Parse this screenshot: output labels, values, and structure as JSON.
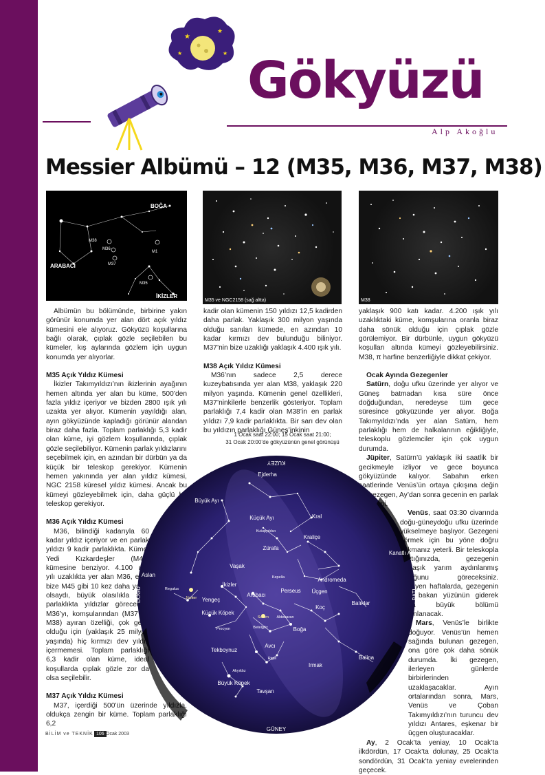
{
  "header": {
    "title": "Gökyüzü",
    "author": "Alp Akoğlu"
  },
  "headline": "Messier Albümü – 12 (M35, M36, M37, M38)",
  "photos": {
    "chart": {
      "labels": {
        "boga": "BOĞA",
        "arabaci": "ARABACI",
        "ikizler": "İKİZLER",
        "m38": "M38",
        "m36": "M36",
        "m37": "M37",
        "m1": "M1",
        "m35": "M35"
      }
    },
    "m35_caption": "M35 ve NGC2158 (sağ altta)",
    "m38_caption": "M38"
  },
  "col1": {
    "intro": "Albümün bu bölümünde, birbirine yakın görünür konumda yer alan dört açık yıldız kümesini ele alıyoruz. Gökyüzü koşullarına bağlı olarak, çıplak gözle seçilebilen bu kümeler, kış aylarında gözlem için uygun konumda yer alıyorlar.",
    "m35_head": "M35 Açık Yıldız Kümesi",
    "m35_text": "İkizler Takımyıldızı’nın ikizlerinin ayağının hemen altında yer alan bu küme, 500’den fazla yıldız içeriyor ve bizden 2800 ışık yılı uzakta yer alıyor. Kümenin yayıldığı alan, ayın gökyüzünde kapladığı görünür alandan biraz daha fazla. Toplam parlaklığı 5,3 kadir olan küme, iyi gözlem koşullarında, çıplak gözle seçilebiliyor. Kümenin parlak yıldızlarını seçebilmek için, en azından bir dürbün ya da küçük bir teleskop gerekiyor. Kümenin hemen yakınında yer alan yıldız kümesi, NGC 2158 küresel yıldız kümesi. Ancak bu kümeyi gözleyebilmek için, daha güçlü bir teleskop gerekiyor.",
    "m36_head": "M36 Açık Yıldız Kümesi",
    "m36_text": "M36, bilindiği kadarıyla 60 kadar yıldız içeriyor ve en parlak yıldızı 9 kadir parlaklıkta. Küme, Yedi Kızkardeşler (M45) kümesine benziyor. 4.100 ışık yılı uzaklıkta yer alan M36, eğer bize M45 gibi 10 kez daha yakın olsaydı, büyük olasılıkla aynı parlaklıkta yıldızlar görecektik. M36’yı, komşularından (M37 ve M38) ayıran özelliği, çok genç olduğu için (yaklaşık 25 milyon yaşında) hiç kırmızı dev yıldız içermemesi. Toplam parlaklığı 6,3 kadir olan küme, ideal koşullarda çıplak gözle zor da olsa seçilebilir.",
    "m37_head": "M37 Açık Yıldız Kümesi",
    "m37_text": "M37, içerdiği 500’ün üzerinde yıldızla, oldukça zengin bir küme. Toplam parlaklığı 6,2"
  },
  "col2": {
    "cont": "kadir olan kümenin 150 yıldızı 12,5 kadirden daha parlak. Yaklaşık 300 milyon yaşında olduğu sanılan kümede, en azından 10 kadar kırmızı dev bulunduğu biliniyor. M37’nin bize uzaklığı yaklaşık 4.400 ışık yılı.",
    "m38_head": "M38 Açık Yıldız Kümesi",
    "m38_text": "M36’nın sadece 2,5 derece kuzeybatısında yer alan M38, yaklaşık 220 milyon yaşında. Kümenin genel özellikleri, M37’ninkilerle benzerlik gösteriyor. Toplam parlaklığı 7,4 kadir olan M38’in en parlak yıldızı 7,9 kadir parlaklıkta. Bir sarı dev olan bu yıldızın parlaklığı Güneş’inkinin",
    "map_caption_1": "1 Ocak saat 22:00; 15 Ocak saat 21:00;",
    "map_caption_2": "31 Ocak 20:00’de gökyüzünün genel görünüşü"
  },
  "col3": {
    "cont": "yaklaşık 900 katı kadar. 4.200 ışık yılı uzaklıktaki küme, komşularına oranla biraz daha sönük olduğu için çıplak gözle görülemiyor. Bir dürbünle, uygun gökyüzü koşulları altında kümeyi gözleyebilirsiniz. M38, π harfine benzerliğiyle dikkat çekiyor.",
    "planets_head": "Ocak Ayında Gezegenler",
    "saturn_name": "Satürn",
    "saturn_text": ", doğu ufku üzerinde yer alıyor ve Güneş batmadan kısa süre önce doğduğundan, neredeyse tüm gece süresince gökyüzünde yer alıyor. Boğa Takımyıldızı’nda yer alan Satürn, hem parlaklığı hem de halkalarının eğikliğiyle, teleskoplu gözlemciler için çok uygun durumda.",
    "jupiter_name": "Jüpiter",
    "jupiter_text": ", Satürn’ü yaklaşık iki saatlik bir gecikmeyle izliyor ve gece boyunca gökyüzünde kalıyor. Sabahın erken saatlerinde Venüs’ün ortaya çıkışına değin bu gezegen, Ay’dan sonra gecenin en parlak gökcismi.",
    "venus_name": "Venüs",
    "venus_text": ", saat 03:30 civarında doğu-güneydoğu ufku üzerinde yükselmeye başlıyor. Gezegeni görmek için bu yöne doğru bakmanız yeterli. Bir teleskopla baktığınızda, gezegenin yaklaşık yarım aydınlanmış olduğunu göreceksiniz. İlerleyen haftalarda, gezegenin bize bakan yüzünün giderek daha büyük bölümü aydınlanacak.",
    "mars_name": "Mars",
    "mars_text": ", Venüs’le birlikte doğuyor. Venüs’ün hemen sağında bulunan gezegen, ona göre çok daha sönük durumda. İki gezegen, ilerleyen günlerde birbirlerinden uzaklaşacaklar. Ayın ortalarından sonra, Mars, Venüs ve Çoban Takımyıldızı’nın turuncu dev yıldızı Antares, eşkenar bir üçgen oluşturacaklar.",
    "ay_name": "Ay",
    "ay_text": ", 2 Ocak’ta yeniay, 10 Ocak’ta ilkdördün, 17 Ocak’ta dolunay, 25 Ocak’ta sondördün, 31 Ocak’ta yeniay evrelerinden geçecek."
  },
  "skymap": {
    "kuzey": "KUZEY",
    "guney": "GÜNEY",
    "dogu": "DOĞU",
    "bati": "BATI",
    "labels": {
      "ejderha": "Ejderha",
      "buyuk_ay": "Büyük Ayı",
      "kucuk_ay": "Küçük Ayı",
      "kutupyildizi": "Kutupyıldızı",
      "kral": "Kral",
      "kralice": "Kraliçe",
      "zurafa": "Zürafa",
      "kanatli_at": "Kanatlı At",
      "vasak": "Vaşak",
      "aslan": "Aslan",
      "ikizler": "İkizler",
      "kepella": "Kepella",
      "arabaci": "Arabacı",
      "perseus": "Perseus",
      "andromeda": "Andromeda",
      "ucgen": "Üçgen",
      "koc": "Koç",
      "baliklar": "Balıklar",
      "yengec": "Yengeç",
      "jupiter": "Jüpiter",
      "regulus": "Regulus",
      "kucuk_kopek": "Küçük Köpek",
      "procyon": "Procyon",
      "saturn": "Satürn",
      "aldebaran": "Aldebaran",
      "betelgeuse": "Betelgöz",
      "boga": "Boğa",
      "tekboynuz": "Tekboynuz",
      "avci": "Avcı",
      "rigel": "Rigel",
      "irmak": "Irmak",
      "balina": "Balina",
      "akyildiz": "Akyıldız",
      "buyuk_kopek": "Büyük Köpek",
      "tavsan": "Tavşan"
    }
  },
  "footer": {
    "brand": "BİLİM ve TEKNİK",
    "page": "106",
    "date": "Ocak 2003"
  }
}
